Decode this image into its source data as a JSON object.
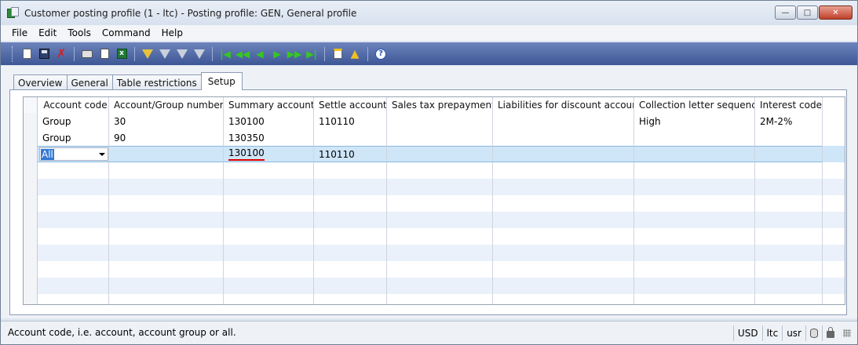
{
  "window": {
    "title": "Customer posting profile (1 - ltc) - Posting profile: GEN, General profile"
  },
  "menu": [
    "File",
    "Edit",
    "Tools",
    "Command",
    "Help"
  ],
  "toolbar": {
    "icons": [
      "new-icon",
      "save-icon",
      "delete-icon",
      "print-icon",
      "print-preview-icon",
      "export-excel-icon",
      "filter-by-selection-icon",
      "filter-by-grid-icon",
      "advanced-filter-icon",
      "remove-filter-icon",
      "first-record-icon",
      "previous-page-icon",
      "previous-record-icon",
      "next-record-icon",
      "next-page-icon",
      "last-record-icon",
      "document-handling-icon",
      "alert-icon",
      "help-icon"
    ],
    "help_glyph": "?"
  },
  "tabs": [
    {
      "label": "Overview"
    },
    {
      "label": "General"
    },
    {
      "label": "Table restrictions"
    },
    {
      "label": "Setup",
      "active": true
    }
  ],
  "grid": {
    "columns": [
      "Account code",
      "Account/Group number",
      "Summary account",
      "Settle account",
      "Sales tax prepayments",
      "Liabilities for discount account",
      "Collection letter sequence",
      "Interest code"
    ],
    "rows": [
      [
        "Group",
        "30",
        "130100",
        "110110",
        "",
        "",
        "High",
        "2M-2%"
      ],
      [
        "Group",
        "90",
        "130350",
        "",
        "",
        "",
        "",
        ""
      ],
      [
        "All",
        "",
        "130100",
        "110110",
        "",
        "",
        "",
        ""
      ]
    ],
    "selected_row": 2,
    "editing_value": "All"
  },
  "status": {
    "text": "Account code, i.e. account, account group or all.",
    "currency": "USD",
    "company": "ltc",
    "user": "usr"
  },
  "colors": {
    "toolbar": "#3d5795",
    "selected_row": "#cfe5f8",
    "alt_row": "#eaf1fa",
    "annotation": "#dd0000"
  }
}
